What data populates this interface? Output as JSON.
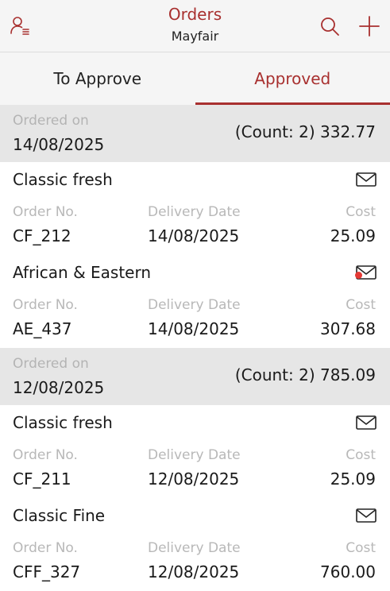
{
  "header": {
    "title": "Orders",
    "subtitle": "Mayfair",
    "icons": {
      "user": "user-list-icon",
      "search": "search-icon",
      "add": "plus-icon"
    },
    "accent_color": "#a8302f"
  },
  "tabs": [
    {
      "label": "To Approve",
      "active": false
    },
    {
      "label": "Approved",
      "active": true
    }
  ],
  "columns": {
    "order_no": "Order No.",
    "delivery_date": "Delivery Date",
    "cost": "Cost"
  },
  "groups": [
    {
      "label": "Ordered on",
      "date": "14/08/2025",
      "total": "(Count: 2) 332.77",
      "orders": [
        {
          "supplier": "Classic fresh",
          "order_no": "CF_212",
          "delivery_date": "14/08/2025",
          "cost": "25.09",
          "unread": false
        },
        {
          "supplier": "African & Eastern",
          "order_no": "AE_437",
          "delivery_date": "14/08/2025",
          "cost": "307.68",
          "unread": true
        }
      ]
    },
    {
      "label": "Ordered on",
      "date": "12/08/2025",
      "total": "(Count: 2) 785.09",
      "orders": [
        {
          "supplier": "Classic fresh",
          "order_no": "CF_211",
          "delivery_date": "12/08/2025",
          "cost": "25.09",
          "unread": false
        },
        {
          "supplier": "Classic Fine",
          "order_no": "CFF_327",
          "delivery_date": "12/08/2025",
          "cost": "760.00",
          "unread": false
        }
      ]
    }
  ]
}
